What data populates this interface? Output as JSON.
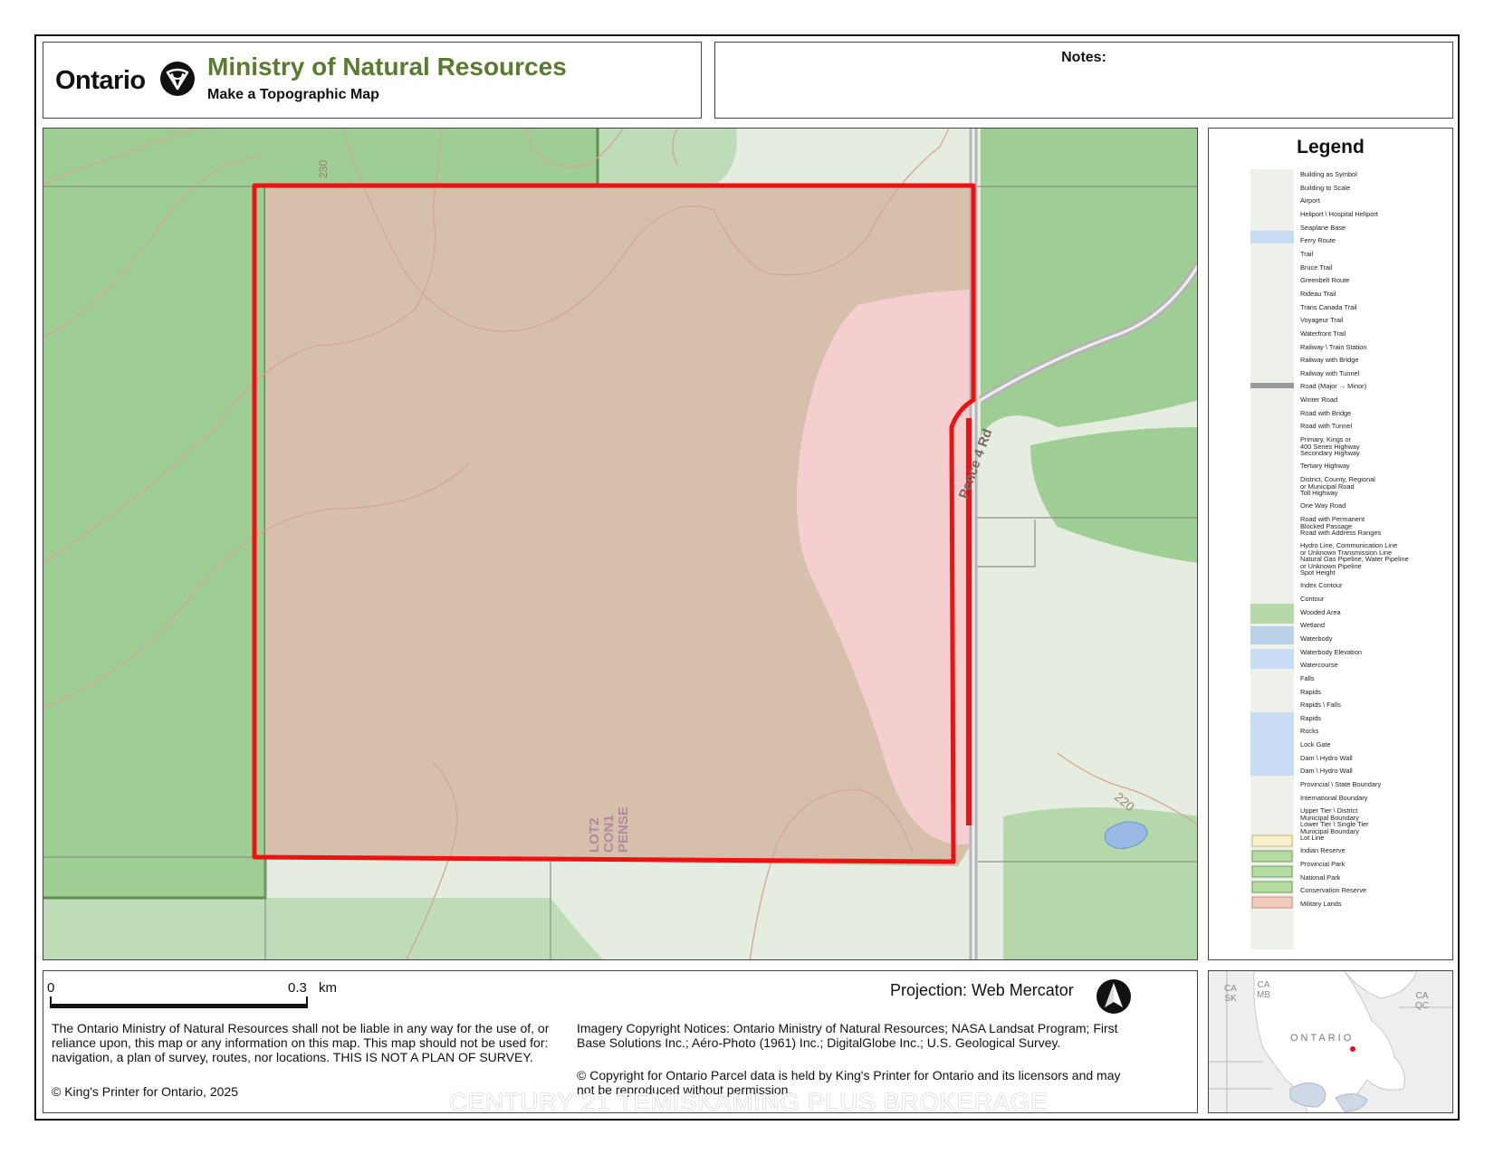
{
  "header": {
    "brand": "Ontario",
    "ministry": "Ministry of Natural Resources",
    "subtitle": "Make a Topographic Map"
  },
  "notes": {
    "label": "Notes:"
  },
  "map": {
    "road_label": "Pence 4 Rd",
    "parcel_label_lines": [
      "LOT2",
      "CON1",
      "PENSE"
    ],
    "contour_labels": [
      "230",
      "220"
    ],
    "colors": {
      "wooded": "#9fce95",
      "open": "#e4eddf",
      "parcel_fill": "#d6c0ab",
      "parcel_pink": "#f5cfcf",
      "parcel_outline": "#ee1111",
      "contour": "#d4a596",
      "road": "#b5b5b5",
      "water": "#9ab9e6"
    }
  },
  "legend": {
    "title": "Legend",
    "items": [
      "Building as Symbol",
      "Building to Scale",
      "Airport",
      "Heliport \\ Hospital Heliport",
      "Seaplane Base",
      "Ferry Route",
      "Trail",
      "Bruce Trail",
      "Greenbelt Route",
      "Rideau Trail",
      "Trans Canada Trail",
      "Voyageur Trail",
      "Waterfront Trail",
      "Railway \\ Train Station",
      "Railway with Bridge",
      "Railway with Tunnel",
      "Road (Major → Minor)",
      "Winter Road",
      "Road with Bridge",
      "Road with Tunnel",
      "Primary, Kings or\n400 Series Highway",
      "Secondary Highway",
      "Tertiary Highway",
      "District, County, Regional\nor Municipal Road",
      "Toll Highway",
      "One Way Road",
      "Road with Permanent\nBlocked Passage",
      "Road with Address Ranges",
      "Hydro Line, Communication Line\nor Unknown Transmission Line",
      "Natural Gas Pipeline, Water Pipeline\nor Unknown Pipeline",
      "Spot Height",
      "Index Contour",
      "Contour",
      "Wooded Area",
      "Wetland",
      "Waterbody",
      "Waterbody Elevation",
      "Watercourse",
      "Falls",
      "Rapids",
      "Rapids \\ Falls",
      "Rapids",
      "Rocks",
      "Lock Gate",
      "Dam \\ Hydro Wall",
      "Dam \\ Hydro Wall",
      "Provincial \\ State Boundary",
      "International Boundary",
      "Upper Tier \\ District\nMunicipal Boundary",
      "Lower Tier \\ Single Tier\nMunicipal Boundary",
      "Lot Line",
      "Indian Reserve",
      "Provincial Park",
      "National Park",
      "Conservation Reserve",
      "Military Lands"
    ]
  },
  "footer": {
    "scale_start": "0",
    "scale_end": "0.3",
    "scale_unit": "km",
    "projection": "Projection: Web Mercator",
    "disclaimer": "The Ontario Ministry of Natural Resources shall not be liable in any way for the use of, or reliance upon, this map or any information on this map.  This map should not be used for: navigation, a plan of survey, routes, nor locations. THIS IS NOT A PLAN OF SURVEY.",
    "kings_printer": "© King's Printer for Ontario,  2025",
    "imagery": "Imagery Copyright Notices: Ontario Ministry of Natural Resources; NASA Landsat Program; First Base Solutions Inc.; Aéro-Photo (1961) Inc.; DigitalGlobe Inc.; U.S. Geological Survey.",
    "parcel_copyright": "© Copyright for Ontario Parcel data is held by King's Printer for Ontario and its licensors and may not be reproduced without permission.",
    "watermark": "CENTURY 21 TEMISKAMING PLUS BROKERAGE"
  },
  "inset": {
    "labels": [
      "CA\nSK",
      "CA\nMB",
      "CA\nQC"
    ],
    "province": "ONTARIO"
  }
}
